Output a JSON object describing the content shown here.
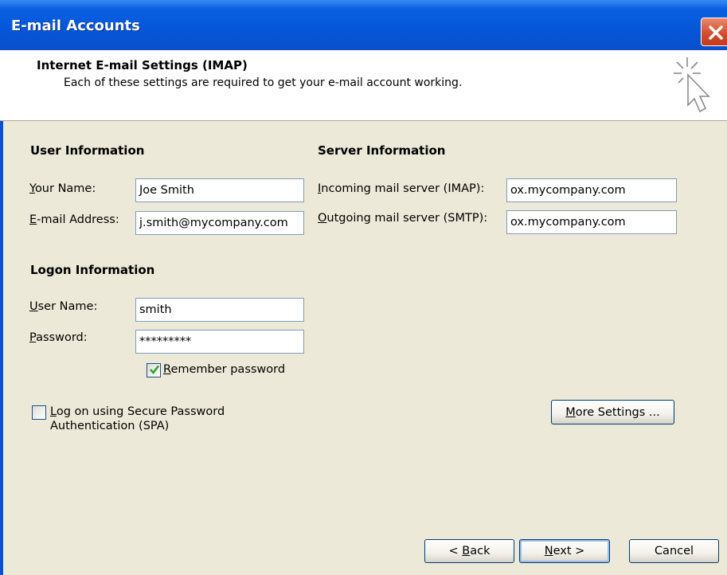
{
  "window": {
    "title": "E-mail Accounts"
  },
  "header": {
    "title": "Internet E-mail Settings (IMAP)",
    "subtitle": "Each of these settings are required to get your e-mail account working."
  },
  "user_info": {
    "heading": "User Information",
    "name_label_key": "Y",
    "name_label_rest": "our Name:",
    "name_value": "Joe Smith",
    "email_label_key": "E",
    "email_label_rest": "-mail Address:",
    "email_value": "j.smith@mycompany.com"
  },
  "server_info": {
    "heading": "Server Information",
    "incoming_label_key": "I",
    "incoming_label_rest": "ncoming mail server (IMAP):",
    "incoming_value": "ox.mycompany.com",
    "outgoing_label_key": "O",
    "outgoing_label_rest": "utgoing mail server (SMTP):",
    "outgoing_value": "ox.mycompany.com"
  },
  "logon_info": {
    "heading": "Logon Information",
    "username_label_key": "U",
    "username_label_rest": "ser Name:",
    "username_value": "smith",
    "password_label_key": "P",
    "password_label_rest": "assword:",
    "password_value": "*********",
    "remember_key": "R",
    "remember_rest": "emember password",
    "remember_checked": true
  },
  "spa": {
    "line1_key": "L",
    "line1_rest": "og on using Secure Password",
    "line2": "Authentication (SPA)",
    "checked": false
  },
  "buttons": {
    "more_settings_key": "M",
    "more_settings_rest": "ore Settings ...",
    "back_prefix": "< ",
    "back_key": "B",
    "back_rest": "ack",
    "next_key": "N",
    "next_rest": "ext >",
    "cancel": "Cancel"
  },
  "colors": {
    "titlebar": "#0556d8",
    "dialog_bg": "#ece9d8",
    "check_green": "#21a121"
  }
}
